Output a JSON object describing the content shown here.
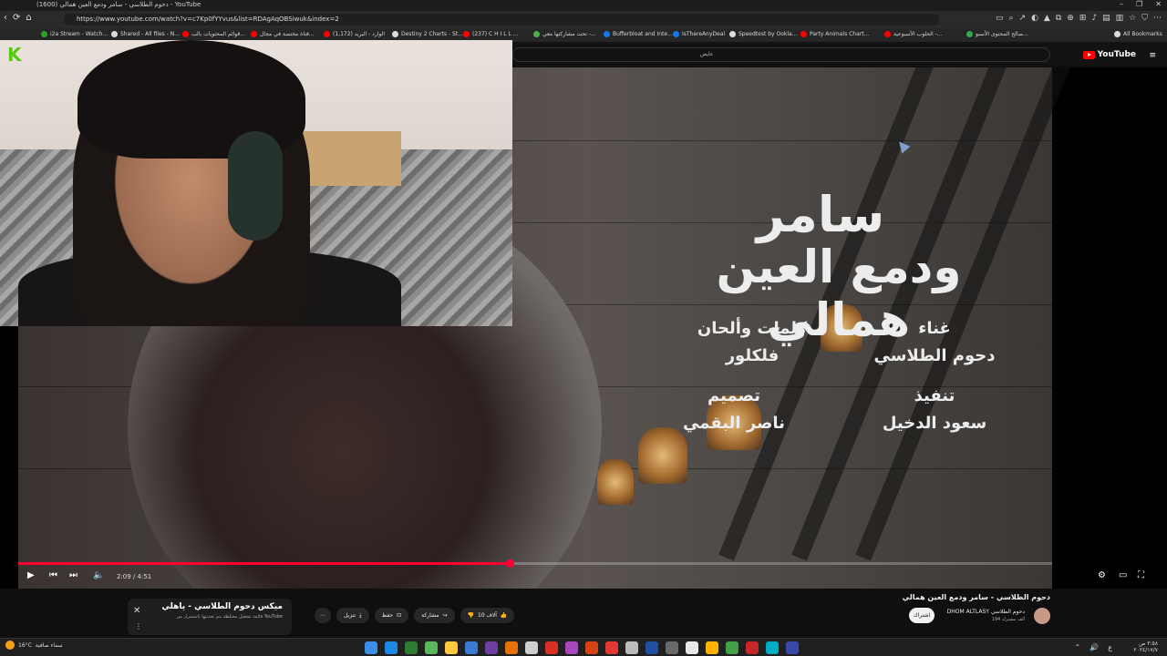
{
  "window": {
    "title": "(1600) دحوم الطلاسي - سامر ودمع العين همالي - YouTube",
    "controls": [
      "–",
      "❐",
      "✕"
    ]
  },
  "browser": {
    "url": "https://www.youtube.com/watch?v=c7Kp0fYYvus&list=RDAgAqOBSiwuk&index=2",
    "nav_icons": [
      "‹",
      "⟳",
      "⌂"
    ],
    "extension_icons": [
      "▭",
      "⌕",
      "↗",
      "◐",
      "▲",
      "⧉",
      "⊕",
      "⊞",
      "♪",
      "▤",
      "▥",
      "☆",
      "⛉",
      "⋯"
    ]
  },
  "bookmarks": [
    {
      "label": "i2a Stream - Watch...",
      "color": "#2aa52a"
    },
    {
      "label": "Shared - All files - N...",
      "color": "#dddddd"
    },
    {
      "label": "قوائم المحتويات بالب...",
      "color": "#ff0000"
    },
    {
      "label": "قناة مختصة في مجال...",
      "color": "#ff0000"
    },
    {
      "label": "(1,172) الوارد - البريد",
      "color": "#ff0000"
    },
    {
      "label": "Destiny 2 Charts - St...",
      "color": "#dddddd"
    },
    {
      "label": "(237) C H I L L ...",
      "color": "#ff0000"
    },
    {
      "label": "تحت مشاركتها معي -...",
      "color": "#4caf50"
    },
    {
      "label": "Bufferbloat and Inte...",
      "color": "#1a73e8"
    },
    {
      "label": "IsThereAnyDeal",
      "color": "#1a73e8"
    },
    {
      "label": "Speedtest by Ookla...",
      "color": "#dddddd"
    },
    {
      "label": "Party Animals Chart...",
      "color": "#ff0000"
    },
    {
      "label": "الحلوب الأسبوعية -...",
      "color": "#ff0000"
    },
    {
      "label": "صالح المحتوى الأسبو...",
      "color": "#34a853"
    },
    {
      "label": "All Bookmarks",
      "color": "#dddddd"
    }
  ],
  "youtube": {
    "logo_text": "YouTube",
    "search_text": "عايض",
    "menu_icon": "≡"
  },
  "video": {
    "overlay_title_line1": "سامر",
    "overlay_title_line2": "ودمع العين همالي",
    "credits": {
      "singing_label": "غناء",
      "singing_value": "دحوم الطلاسي",
      "lyrics_label": "كلمات وألحان",
      "lyrics_value": "فلكلور",
      "execution_label": "تنفيذ",
      "execution_value": "سعود الدخيل",
      "design_label": "تصميم",
      "design_value": "ناصر البقمي"
    },
    "webcam_logo": "K"
  },
  "player": {
    "progress_fraction": 0.475,
    "current_time": "2:09",
    "duration": "4:51",
    "time_display": "2:09 / 4:51",
    "play_icon": "▶",
    "prev_icon": "⏮",
    "next_icon": "⏭",
    "volume_icon": "🔈",
    "settings_icon": "⚙",
    "theater_icon": "▭",
    "fullscreen_icon": "⛶"
  },
  "info": {
    "title": "دحوم الطلاسي - سامر ودمع العين همالي",
    "channel": "DHOM ALTLASY دحوم الطلاسي",
    "subscribers": "194 ألف مشترك",
    "subscribe_label": "اشتراك",
    "like_count": "10 آلاف",
    "share_label": "مشاركة",
    "save_label": "حفظ",
    "download_label": "تنزيل",
    "more_label": "⋯"
  },
  "mix": {
    "title": "ميكس دحوم الطلاسي - ياهلي",
    "subtitle": "قائمة تشغيل مختلطة يتم تحديثها باستمرار من YouTube",
    "close_icon": "✕",
    "menu_icon": "⋮"
  },
  "taskbar": {
    "temperature": "16°C",
    "weather_text": "سماء صافية",
    "clock_time": "٣:٥٨ ص",
    "clock_date": "٢٠٢٤/١٧/٧",
    "tray_icons": [
      "⌃",
      "🔊",
      "ع",
      "⌂"
    ],
    "app_colors": [
      "#3c8fe6",
      "#1e88e5",
      "#2f7d32",
      "#58b95c",
      "#ffc83d",
      "#3a7bd5",
      "#6b3fa0",
      "#e8710a",
      "#cfcfcf",
      "#d93025",
      "#ab47bc",
      "#d84315",
      "#e53935",
      "#bbbbbb",
      "#1e4fa3",
      "#6a6a6a",
      "#e8e8e8",
      "#ffb300",
      "#43a047",
      "#c62828",
      "#00acc1",
      "#3949ab"
    ]
  }
}
